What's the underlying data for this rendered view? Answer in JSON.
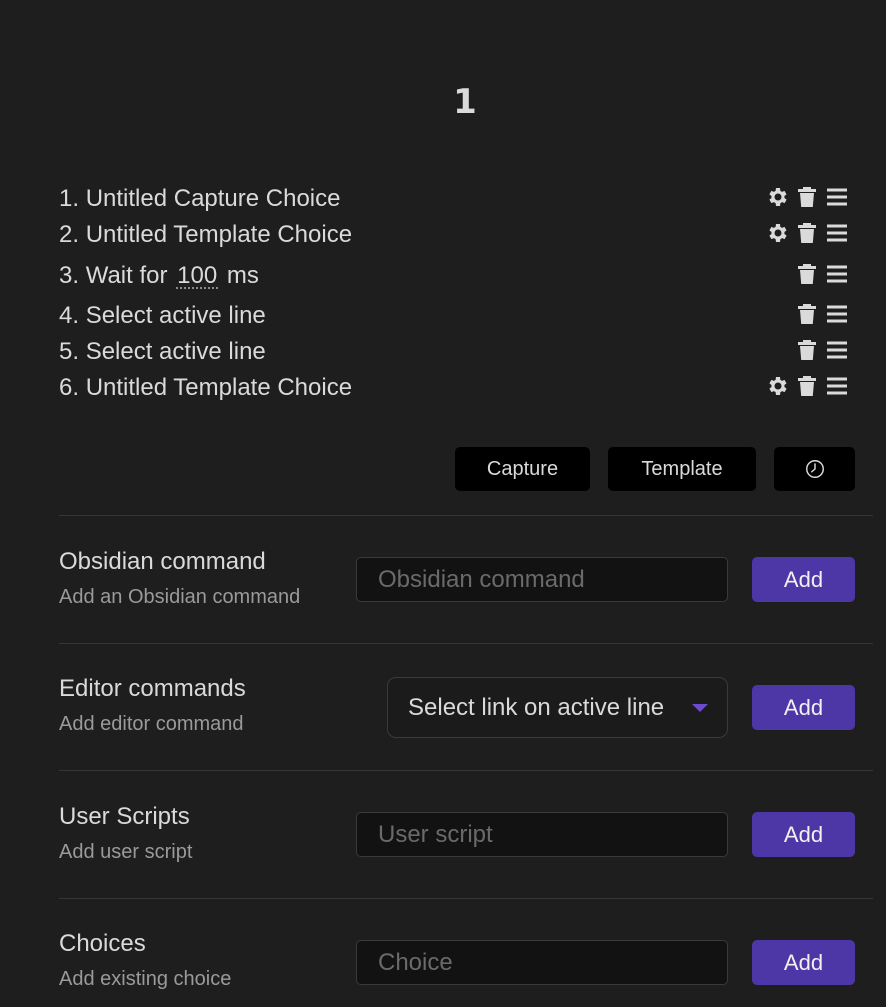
{
  "macro": {
    "title": "1"
  },
  "commands": [
    {
      "index": "1.",
      "label": "Untitled Capture Choice",
      "icons": [
        "gear-icon",
        "trash-icon",
        "drag-handle-icon"
      ]
    },
    {
      "index": "2.",
      "label": "Untitled Template Choice",
      "icons": [
        "gear-icon",
        "trash-icon",
        "drag-handle-icon"
      ]
    },
    {
      "index": "3.",
      "label_prefix": "Wait for",
      "value": "100",
      "label_suffix": "ms",
      "icons": [
        "trash-icon",
        "drag-handle-icon"
      ]
    },
    {
      "index": "4.",
      "label": "Select active line",
      "icons": [
        "trash-icon",
        "drag-handle-icon"
      ]
    },
    {
      "index": "5.",
      "label": "Select active line",
      "icons": [
        "trash-icon",
        "drag-handle-icon"
      ]
    },
    {
      "index": "6.",
      "label": "Untitled Template Choice",
      "icons": [
        "gear-icon",
        "trash-icon",
        "drag-handle-icon"
      ]
    }
  ],
  "toolbar": {
    "capture_label": "Capture",
    "template_label": "Template",
    "wait_icon": "clock-icon"
  },
  "settings": {
    "obsidian": {
      "name": "Obsidian command",
      "desc": "Add an Obsidian command",
      "placeholder": "Obsidian command",
      "button": "Add"
    },
    "editor": {
      "name": "Editor commands",
      "desc": "Add editor command",
      "selected": "Select link on active line",
      "button": "Add"
    },
    "scripts": {
      "name": "User Scripts",
      "desc": "Add user script",
      "placeholder": "User script",
      "button": "Add"
    },
    "choices": {
      "name": "Choices",
      "desc": "Add existing choice",
      "placeholder": "Choice",
      "button": "Add"
    }
  },
  "colors": {
    "background": "#1e1e1e",
    "accent": "#4d37a6",
    "text": "#dadada",
    "muted": "#9a9a9a"
  }
}
